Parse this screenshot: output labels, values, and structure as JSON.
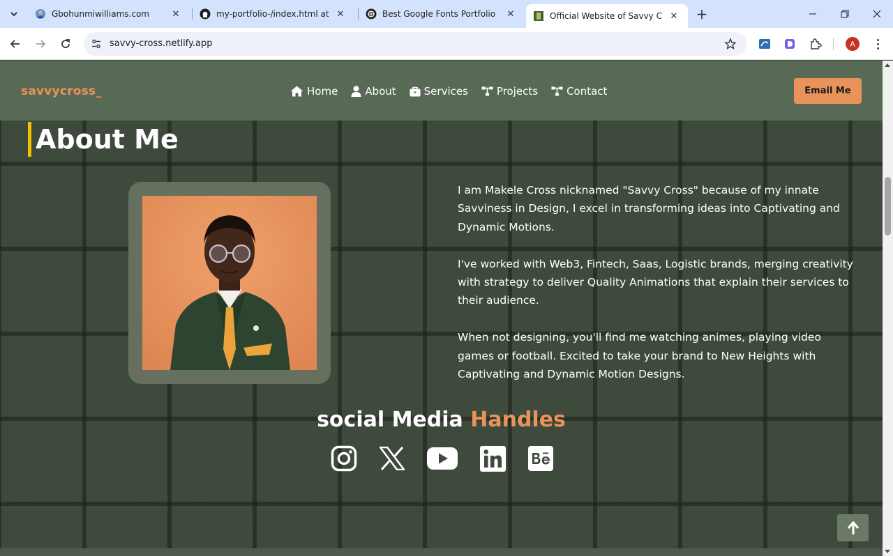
{
  "browser": {
    "tabs": [
      {
        "title": "Gbohunmiwilliams.com",
        "favicon": "globe-avatar-icon",
        "active": false
      },
      {
        "title": "my-portfolio-/index.html at ma",
        "favicon": "github-icon",
        "active": false
      },
      {
        "title": "Best Google Fonts Portfolio",
        "favicon": "openai-icon",
        "active": false
      },
      {
        "title": "Official Website of Savvy Cross |",
        "favicon": "savvy-favicon",
        "active": true
      }
    ],
    "new_tab_label": "+",
    "url": "savvy-cross.netlify.app",
    "profile_initial": "A"
  },
  "site": {
    "logo": "savvycross_",
    "nav": [
      {
        "label": "Home",
        "icon": "home-icon"
      },
      {
        "label": "About",
        "icon": "user-icon"
      },
      {
        "label": "Services",
        "icon": "briefcase-icon"
      },
      {
        "label": "Projects",
        "icon": "sitemap-icon"
      },
      {
        "label": "Contact",
        "icon": "sitemap-icon"
      }
    ],
    "email_button": "Email Me",
    "colors": {
      "accent": "#e8935a",
      "title_bar": "#f2c300",
      "header_bg": "#586a55",
      "page_bg": "#3e4a3c"
    }
  },
  "about": {
    "title": "About Me",
    "paragraphs": [
      "I am Makele Cross nicknamed \"Savvy Cross\" because of my innate Savviness in Design, I excel in transforming ideas into Captivating and Dynamic Motions.",
      "I've worked with Web3, Fintech, Saas, Logistic brands, merging creativity with strategy to deliver Quality Animations that explain their services to their audience.",
      "When not designing, you'll find me watching animes, playing video games or football. Excited to take your brand to New Heights with Captivating and Dynamic Motion Designs."
    ]
  },
  "social": {
    "title_part1": "social Media ",
    "title_part2": "Handles",
    "icons": [
      "instagram-icon",
      "x-twitter-icon",
      "youtube-icon",
      "linkedin-icon",
      "behance-icon"
    ]
  }
}
